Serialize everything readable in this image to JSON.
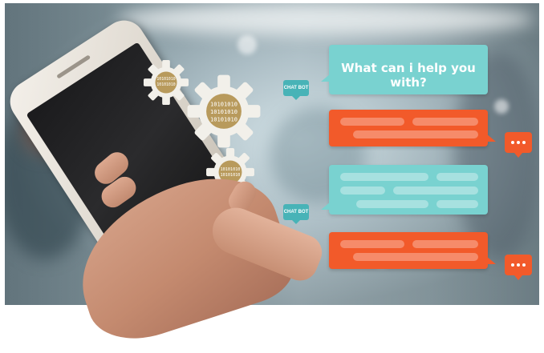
{
  "scene": {
    "headline": "What can i help you with?",
    "bot_tag_1": "CHAT BOT",
    "bot_tag_2": "CHAT BOT",
    "gear_pattern": "10101010",
    "colors": {
      "teal_bubble": "#79d2d0",
      "orange_bubble": "#f25a2a",
      "bot_tag": "#48b3b7",
      "gear": "#f2f0ea"
    },
    "icons": [
      "gear-icon",
      "typing-dots-icon",
      "chat-bot-tag-icon"
    ]
  }
}
